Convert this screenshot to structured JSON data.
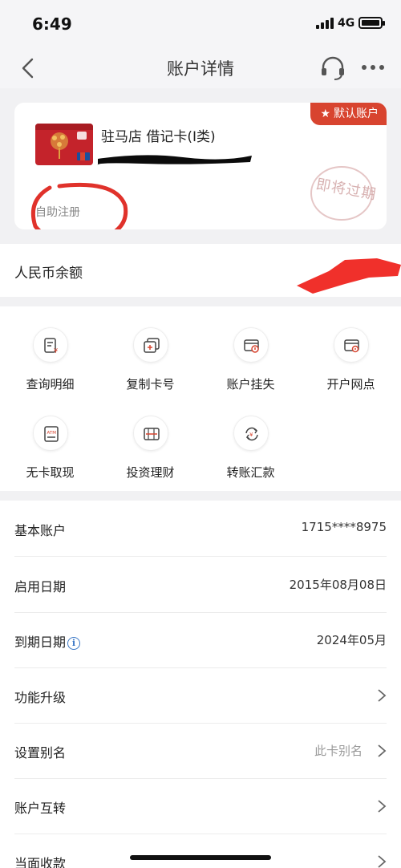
{
  "status_bar": {
    "time": "6:49",
    "network": "4G"
  },
  "nav": {
    "title": "账户详情",
    "back_icon": "chevron-left-icon",
    "service_icon": "headset-icon",
    "more_icon": "more-icon"
  },
  "card": {
    "name": "驻马店 借记卡(Ⅰ类)",
    "default_badge": "默认账户",
    "expire_stamp": "即将过期",
    "self_register": "自助注册",
    "accent": "#d8442f"
  },
  "balance": {
    "label": "人民币余额"
  },
  "functions": [
    {
      "label": "查询明细",
      "icon": "statement-icon"
    },
    {
      "label": "复制卡号",
      "icon": "copy-card-icon"
    },
    {
      "label": "账户挂失",
      "icon": "report-loss-icon"
    },
    {
      "label": "开户网点",
      "icon": "branch-location-icon"
    },
    {
      "label": "无卡取现",
      "icon": "atm-icon"
    },
    {
      "label": "投资理财",
      "icon": "investment-icon"
    },
    {
      "label": "转账汇款",
      "icon": "transfer-icon"
    }
  ],
  "details": [
    {
      "label": "基本账户",
      "value": "1715****8975"
    },
    {
      "label": "启用日期",
      "value": "2015年08月08日"
    },
    {
      "label": "到期日期",
      "value": "2024年05月",
      "info_icon": "info-icon"
    },
    {
      "label": "功能升级",
      "value": ""
    },
    {
      "label": "设置别名",
      "value": "此卡别名"
    },
    {
      "label": "账户互转",
      "value": ""
    },
    {
      "label": "当面收款",
      "value": ""
    }
  ]
}
